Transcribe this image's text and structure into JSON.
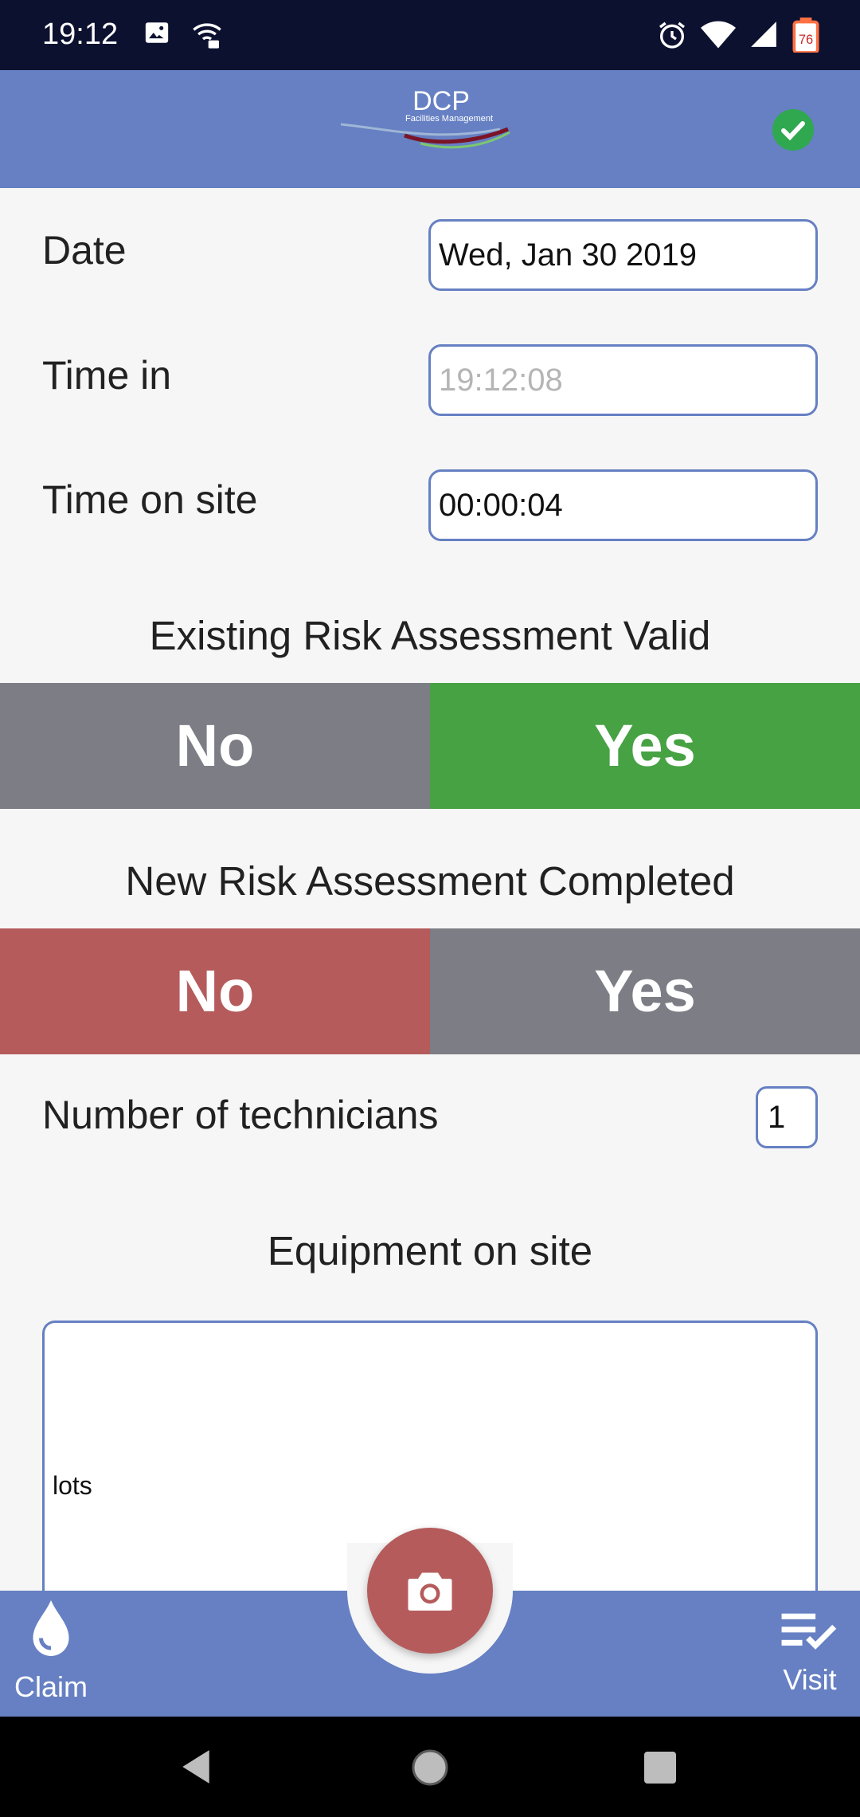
{
  "status_bar": {
    "time": "19:12",
    "battery_level": "76"
  },
  "header": {
    "logo_text": "DCP",
    "logo_subtext": "Facilities Management",
    "sync_status": "check-circle-icon"
  },
  "form": {
    "date": {
      "label": "Date",
      "value": "Wed, Jan 30 2019"
    },
    "time_in": {
      "label": "Time in",
      "placeholder": "19:12:08"
    },
    "time_on_site": {
      "label": "Time on site",
      "value": "00:00:04"
    },
    "existing_risk": {
      "title": "Existing Risk Assessment Valid",
      "no_label": "No",
      "yes_label": "Yes",
      "selected": "Yes"
    },
    "new_risk": {
      "title": "New Risk Assessment Completed",
      "no_label": "No",
      "yes_label": "Yes",
      "selected": "No"
    },
    "technicians": {
      "label": "Number of technicians",
      "value": "1"
    },
    "equipment": {
      "title": "Equipment on site",
      "value": "lots"
    }
  },
  "bottom_bar": {
    "claim_label": "Claim",
    "visit_label": "Visit"
  },
  "colors": {
    "primary": "#6680c3",
    "selected_yes": "#47a244",
    "selected_no": "#b55b5b",
    "unselected": "#7d7d85",
    "fab": "#b55b5b"
  }
}
